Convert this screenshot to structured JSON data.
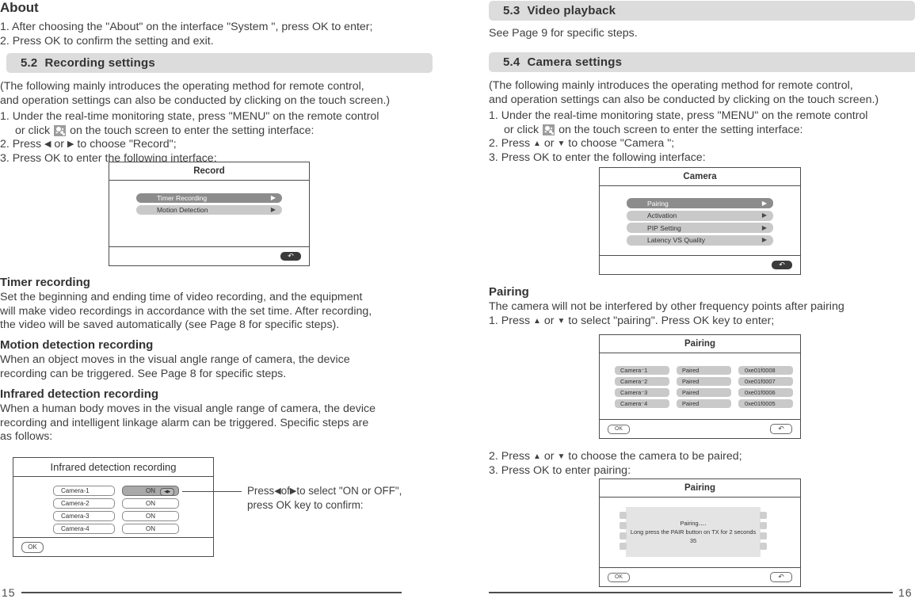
{
  "left_page": {
    "about": {
      "heading": "About",
      "steps": [
        "1. After choosing the \"About\" on the interface \"System \", press OK to enter;",
        "2. Press OK to confirm the setting and exit."
      ]
    },
    "section": {
      "number": "5.2",
      "title": "Recording settings"
    },
    "intro": [
      "(The following mainly introduces the operating method for remote control,",
      " and operation settings can also be conducted by clicking on the touch screen.)"
    ],
    "steps": {
      "s1a": "1. Under the real-time monitoring state, press \"MENU\" on the remote control",
      "s1b_pre": "or click",
      "s1b_post": "on the touch screen to enter the setting interface:",
      "s2_pre": "2. Press",
      "s2_mid": "or",
      "s2_post": "to choose \"Record\";",
      "s3": "3. Press OK to enter the following interface:"
    },
    "record_dialog": {
      "title": "Record",
      "items": [
        {
          "label": "Timer  Recording",
          "selected": true
        },
        {
          "label": "Motion Detection",
          "selected": false
        }
      ],
      "back_icon": "back-arrow-icon"
    },
    "timer_recording": {
      "heading": "Timer recording",
      "lines": [
        "Set the beginning and ending time of video recording, and the equipment",
        "will make video recordings in accordance with the set time. After recording,",
        "the video will be saved automatically (see Page 8 for specific steps)."
      ]
    },
    "motion_detection": {
      "heading": "Motion detection recording",
      "lines": [
        "When an object moves in the visual angle range of camera, the device",
        "recording can be triggered. See Page 8 for specific steps."
      ]
    },
    "infrared_detection": {
      "heading": "Infrared detection recording",
      "lines": [
        "When a human body moves in the visual angle range of camera, the device",
        "recording and intelligent linkage alarm can be triggered. Specific steps are",
        "as follows:"
      ]
    },
    "infrared_panel": {
      "title": "Infrared detection recording",
      "rows": [
        {
          "camera": "Camera-1",
          "value": "ON",
          "selected": true
        },
        {
          "camera": "Camera-2",
          "value": "ON",
          "selected": false
        },
        {
          "camera": "Camera-3",
          "value": "ON",
          "selected": false
        },
        {
          "camera": "Camera-4",
          "value": "ON",
          "selected": false
        }
      ],
      "ok_label": "OK"
    },
    "callout": {
      "line1_pre": "Press",
      "line1_mid": "of",
      "line1_post": "to select \"ON or OFF\",",
      "line2": "press OK key to confirm:"
    },
    "page_number": "15"
  },
  "right_page": {
    "section_53": {
      "number": "5.3",
      "title": "Video playback"
    },
    "video_playback_text": "See Page 9 for specific steps.",
    "section_54": {
      "number": "5.4",
      "title": "Camera settings"
    },
    "intro": [
      "(The following mainly introduces the operating method for remote control,",
      " and operation settings can also be conducted by clicking on the touch screen.)"
    ],
    "steps": {
      "s1a": "1. Under the real-time monitoring state, press \"MENU\" on the remote control",
      "s1b_pre": "or click",
      "s1b_post": "on the touch screen to enter the setting interface:",
      "s2_pre": "2. Press",
      "s2_mid": "or",
      "s2_post": "to choose \"Camera \";",
      "s3": "3. Press OK to enter the following interface:"
    },
    "camera_dialog": {
      "title": "Camera",
      "items": [
        {
          "label": "Pairing",
          "selected": true
        },
        {
          "label": "Activation",
          "selected": false
        },
        {
          "label": "PIP  Setting",
          "selected": false
        },
        {
          "label": "Latency VS Quality",
          "selected": false
        }
      ],
      "back_icon": "back-arrow-icon"
    },
    "pairing": {
      "heading": "Pairing",
      "desc": "The camera will not be interfered by other frequency points after pairing",
      "step1_pre": "1. Press",
      "step1_mid": "or",
      "step1_post": "to select \"pairing\". Press OK key to enter;",
      "step2_pre": "2. Press",
      "step2_mid": "or",
      "step2_post": "to choose the camera to be paired;",
      "step3": "3. Press OK to enter pairing:"
    },
    "pairing_table": {
      "title": "Pairing",
      "rows": [
        {
          "camera": "Camera⁻1",
          "status": "Paired",
          "id": "0xe01f0008"
        },
        {
          "camera": "Camera⁻2",
          "status": "Paired",
          "id": "0xe01f0007"
        },
        {
          "camera": "Camera⁻3",
          "status": "Paired",
          "id": "0xe01f0006"
        },
        {
          "camera": "Camera⁻4",
          "status": "Paired",
          "id": "0xe01f0005"
        }
      ],
      "ok_label": "OK",
      "back_icon": "back-arrow-icon"
    },
    "pairing_progress": {
      "title": "Pairing",
      "line1": "Pairing‥‥",
      "line2": "Long  press  the  PAIR  button  on  TX  for  2  seconds",
      "line3": "35",
      "ok_label": "OK",
      "back_icon": "back-arrow-icon"
    },
    "page_number": "16"
  },
  "colors": {
    "section_bar_bg": "#dcdcdc",
    "row_selected_bg": "#8c8c8c",
    "row_bg": "#c9c9c9",
    "border": "#4d4d4d",
    "text": "#3f3f3f"
  }
}
